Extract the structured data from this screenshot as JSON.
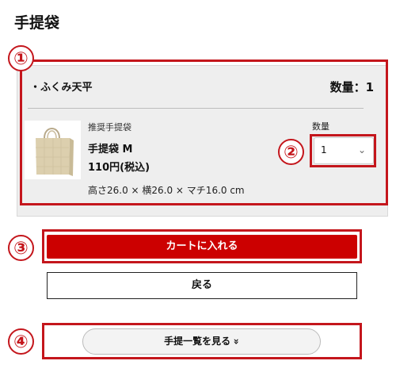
{
  "page": {
    "title": "手提袋"
  },
  "callouts": [
    "①",
    "②",
    "③",
    "④"
  ],
  "cart_group": {
    "shop_name": "・ふくみ天平",
    "quantity_total": "数量：1",
    "item": {
      "category": "推奨手提袋",
      "name": "手提袋 M",
      "price": "110円(税込)",
      "dimensions": "高さ26.0 × 横26.0 × マチ16.0 cm",
      "quantity_label": "数量",
      "quantity_value": "1",
      "image_icon": "paper-bag-icon"
    }
  },
  "buttons": {
    "add_to_cart": "カートに入れる",
    "back": "戻る",
    "view_list": "手提一覧を見る",
    "view_list_icon": "double-chevron-down-icon"
  },
  "colors": {
    "accent": "#cc0000",
    "callout": "#c4161c"
  }
}
